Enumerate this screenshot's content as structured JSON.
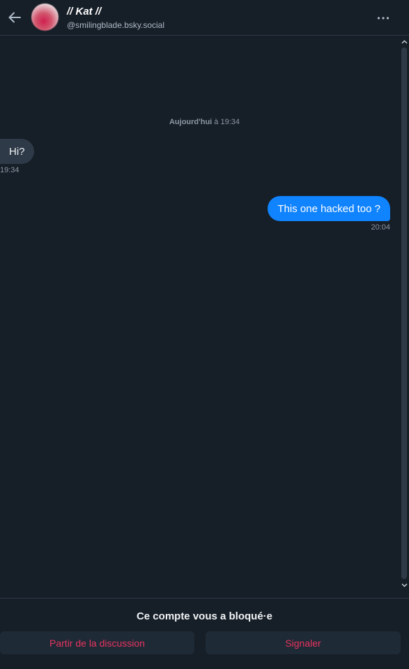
{
  "header": {
    "display_name": "// Kat //",
    "handle": "@smilingblade.bsky.social"
  },
  "conversation": {
    "date_separator_day": "Aujourd'hui",
    "date_separator_rest": " à 19:34",
    "messages": [
      {
        "direction": "incoming",
        "text": "Hi?",
        "time": "19:34"
      },
      {
        "direction": "outgoing",
        "text": "This one hacked too ?",
        "time": "20:04"
      }
    ]
  },
  "footer": {
    "blocked_notice": "Ce compte vous a bloqué·e",
    "leave_label": "Partir de la discussion",
    "report_label": "Signaler"
  },
  "colors": {
    "background": "#161e27",
    "incoming_bubble": "#2e3a48",
    "outgoing_bubble": "#1083fe",
    "danger_text": "#e8345f"
  },
  "icons": {
    "back": "arrow-left-icon",
    "more": "ellipsis-horizontal-icon",
    "scroll_up": "chevron-up-icon",
    "scroll_down": "chevron-down-icon"
  }
}
